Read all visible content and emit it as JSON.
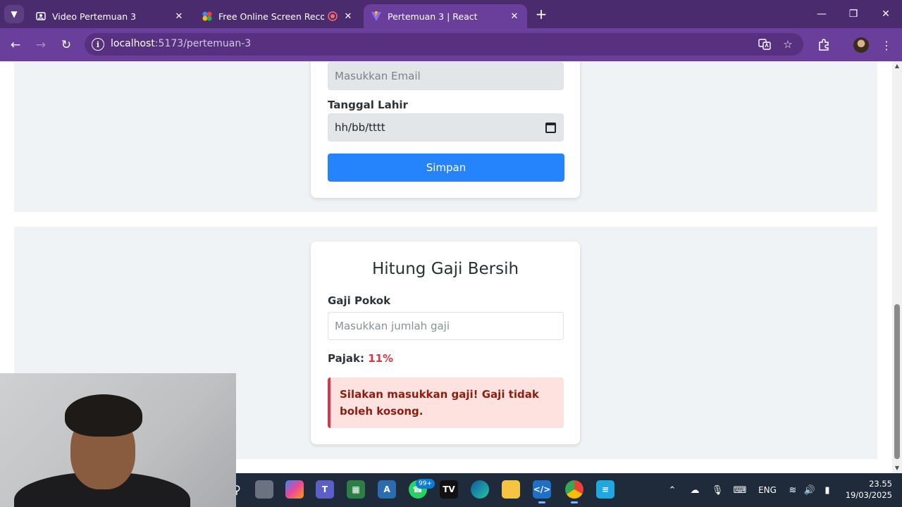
{
  "browser": {
    "tabs": [
      {
        "title": "Video Pertemuan 3",
        "favicon": "video-icon",
        "active": false
      },
      {
        "title": "Free Online Screen Recorder",
        "favicon": "screen-recorder-icon",
        "recording": true,
        "active": false
      },
      {
        "title": "Pertemuan 3 | React",
        "favicon": "vite-icon",
        "active": true
      }
    ],
    "url": {
      "host": "localhost",
      "path": ":5173/pertemuan-3"
    }
  },
  "form_card": {
    "email_placeholder": "Masukkan Email",
    "dob_label": "Tanggal Lahir",
    "dob_placeholder": "hh/bb/tttt",
    "submit_label": "Simpan"
  },
  "salary_card": {
    "title": "Hitung Gaji Bersih",
    "base_label": "Gaji Pokok",
    "base_placeholder": "Masukkan jumlah gaji",
    "tax_label": "Pajak:",
    "tax_value": "11%",
    "alert_text": "Silakan masukkan gaji! Gaji tidak boleh kosong."
  },
  "taskbar": {
    "notification_badge": "99+",
    "language": "ENG",
    "time": "23.55",
    "date": "19/03/2025"
  },
  "colors": {
    "primary_button": "#2583fb",
    "danger": "#dc3545",
    "alert_bg": "#fde2df",
    "browser_frame": "#6a3f9c"
  }
}
